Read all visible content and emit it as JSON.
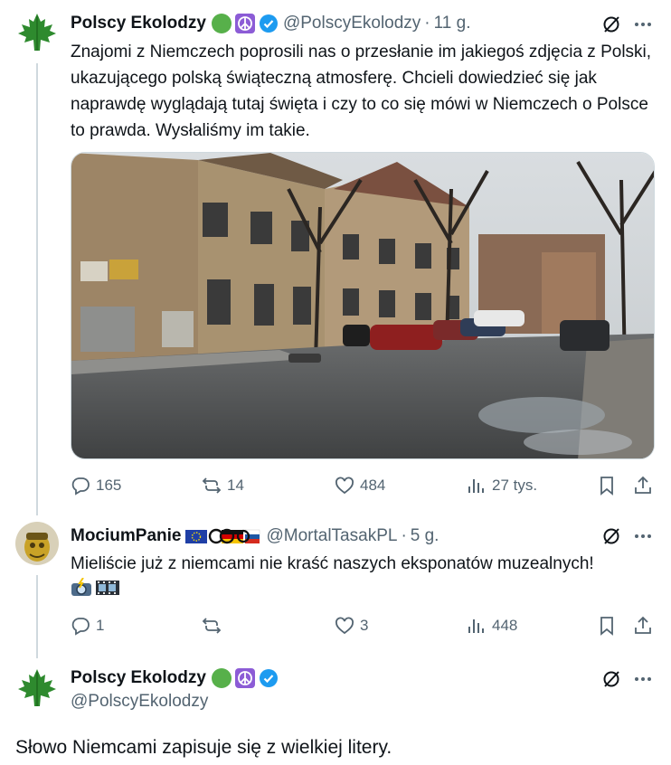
{
  "tweets": [
    {
      "name": "Polscy Ekolodzy",
      "handle": "@PolscyEkolodzy",
      "time": "11 g.",
      "text_highlight": "Znajomi z Niemczech",
      "text_rest": " poprosili nas o przesłanie im jakiegoś zdjęcia z Polski, ukazującego polską świąteczną atmosferę. Chcieli dowiedzieć się jak naprawdę wyglądają tutaj święta i czy to co się mówi w Niemczech o Polsce to prawda. Wysłaliśmy im takie.",
      "replies": "165",
      "reposts": "14",
      "likes": "484",
      "views": "27 tys."
    },
    {
      "name": "MociumPanie",
      "handle": "@MortalTasakPL",
      "time": "5 g.",
      "text": "Mieliście już z niemcami nie kraść naszych eksponatów muzealnych!",
      "replies": "1",
      "reposts": "",
      "likes": "3",
      "views": "448"
    },
    {
      "name": "Polscy Ekolodzy",
      "handle": "@PolscyEkolodzy",
      "text": "Słowo Niemcami zapisuje się z wielkiej litery."
    }
  ],
  "colors": {
    "accent": "#1d9bf0",
    "muted": "#536471",
    "highlight": "#f3f033",
    "green_badge": "#57b04a",
    "peace_badge": "#8c5cd6"
  }
}
